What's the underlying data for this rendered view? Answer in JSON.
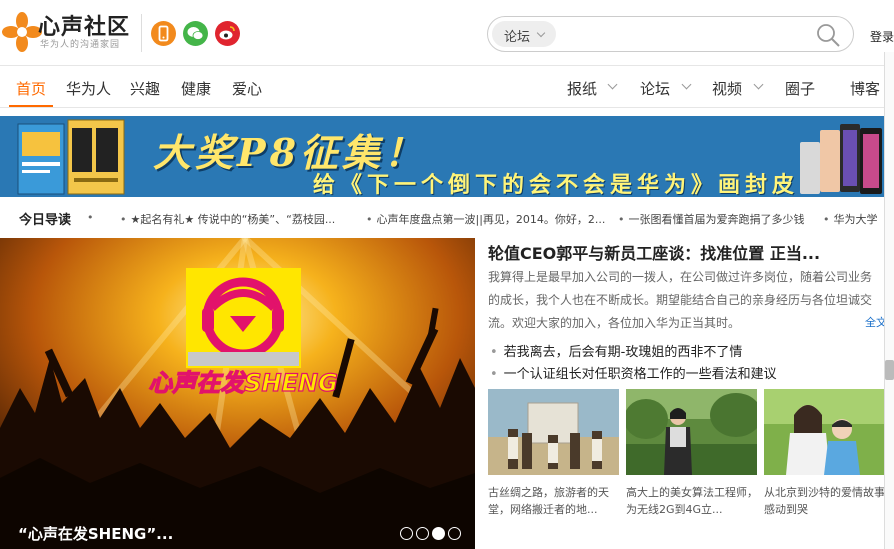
{
  "brand": {
    "name": "心声社区",
    "slogan": "华为人的沟通家园"
  },
  "header": {
    "search": {
      "category": "论坛",
      "placeholder": "",
      "value": ""
    },
    "login": "登录"
  },
  "nav": {
    "left": [
      "首页",
      "华为人",
      "兴趣",
      "健康",
      "爱心"
    ],
    "right": [
      "报纸",
      "论坛",
      "视频",
      "圈子",
      "博客"
    ],
    "active": "首页"
  },
  "banner": {
    "title": "大奖P8征集！",
    "subtitle": "给《下一个倒下的会不会是华为》画封皮"
  },
  "ticker": {
    "label": "今日导读",
    "items": [
      "★起名有礼★ 传说中的“杨美”、“荔枝园...",
      "心声年度盘点第一波||再见，2014。你好，2...",
      "一张图看懂首届为爱奔跑捐了多少钱",
      "华为大学"
    ]
  },
  "hero": {
    "logo_text": "心声在发SHENG",
    "caption": "“心声在发SHENG”...",
    "slide_count": 4,
    "active_slide": 3
  },
  "article": {
    "title": "轮值CEO郭平与新员工座谈：找准位置 正当...",
    "summary": [
      "我算得上是最早加入公司的一拨人，在公司做过许多岗位，随着公司业务",
      "的成长，我个人也在不断成长。期望能结合自己的亲身经历与各位坦诚交",
      "流。欢迎大家的加入，各位加入华为正当其时。"
    ],
    "fulltext": "全文",
    "links": [
      "若我离去，后会有期-玫瑰姐的西非不了情",
      "一个认证组长对任职资格工作的一些看法和建议"
    ]
  },
  "thumbnails": [
    {
      "caption": [
        "古丝绸之路，旅游者的天",
        "堂，网络搬迁者的地..."
      ]
    },
    {
      "caption": [
        "高大上的美女算法工程师，",
        "为无线2G到4G立..."
      ]
    },
    {
      "caption": [
        "从北京到沙特的爱情故事",
        "感动到哭"
      ]
    }
  ],
  "colors": {
    "accent": "#ff6a00",
    "banner_bg": "#2a78b4",
    "link": "#1a6fc9"
  },
  "icons": {
    "social": [
      "phone-icon",
      "wechat-icon",
      "weibo-icon"
    ],
    "search": "search-icon"
  }
}
